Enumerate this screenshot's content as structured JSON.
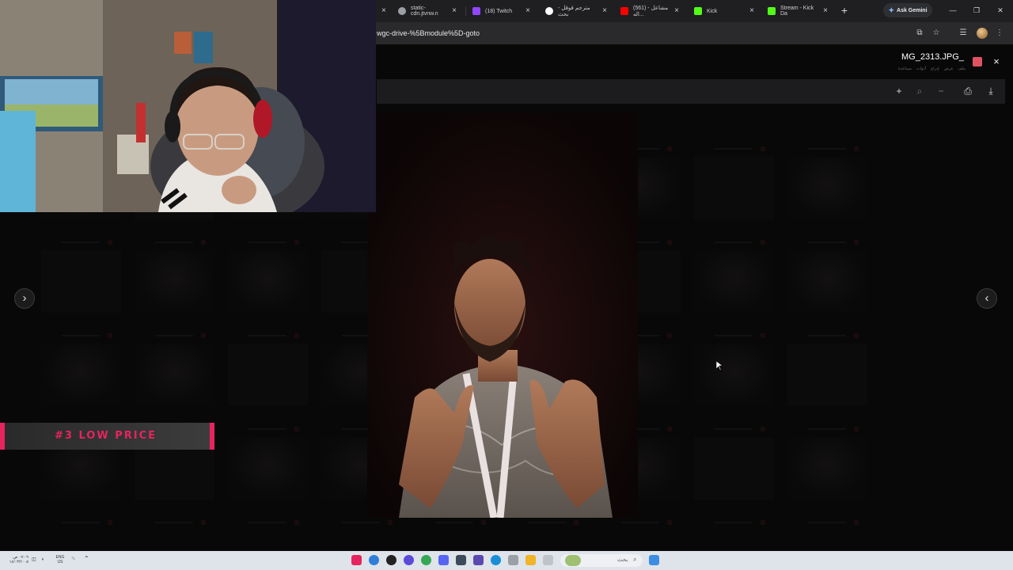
{
  "browser": {
    "tabs": [
      {
        "label": "",
        "favicon_color": "#444448"
      },
      {
        "label": "static-cdn.jtvnw.n",
        "favicon_color": "#9aa0a6"
      },
      {
        "label": "(18) Twitch",
        "favicon_color": "#9146ff"
      },
      {
        "label": "مترجم قوقل - بحث",
        "favicon_color": "#ffffff"
      },
      {
        "label": "(561) مشاعل - اله...",
        "favicon_color": "#ff0000"
      },
      {
        "label": "Kick",
        "favicon_color": "#53fc18"
      },
      {
        "label": "Stream - Kick Da",
        "favicon_color": "#53fc18"
      }
    ],
    "new_tab_label": "+",
    "gemini_label": "Ask Gemini",
    "url": "wgc-drive-%5Bmodule%5D-goto"
  },
  "viewer": {
    "file_title": "MG_2313.JPG_",
    "menu_items": [
      "ملف",
      "عرض",
      "إدراج",
      "أدوات",
      "مساعدة"
    ],
    "close_label": "×"
  },
  "overlay": {
    "banner_text": "#3 LOW PRICE"
  },
  "taskbar": {
    "time": "٠٧:٠٩ ص",
    "date": "١٤/٠٣/٢٠٠٥",
    "lang": "ENG",
    "region": "US",
    "search_placeholder": "بحث"
  },
  "colors": {
    "accent": "#e6245e",
    "viewer_bg": "#121213",
    "taskbar_bg": "#dfe3ea"
  },
  "icons": {
    "prev": "chevron-right-icon",
    "next": "chevron-left-icon",
    "print": "print-icon",
    "download": "download-icon",
    "zoom": "zoom-icon",
    "add": "plus-icon"
  }
}
